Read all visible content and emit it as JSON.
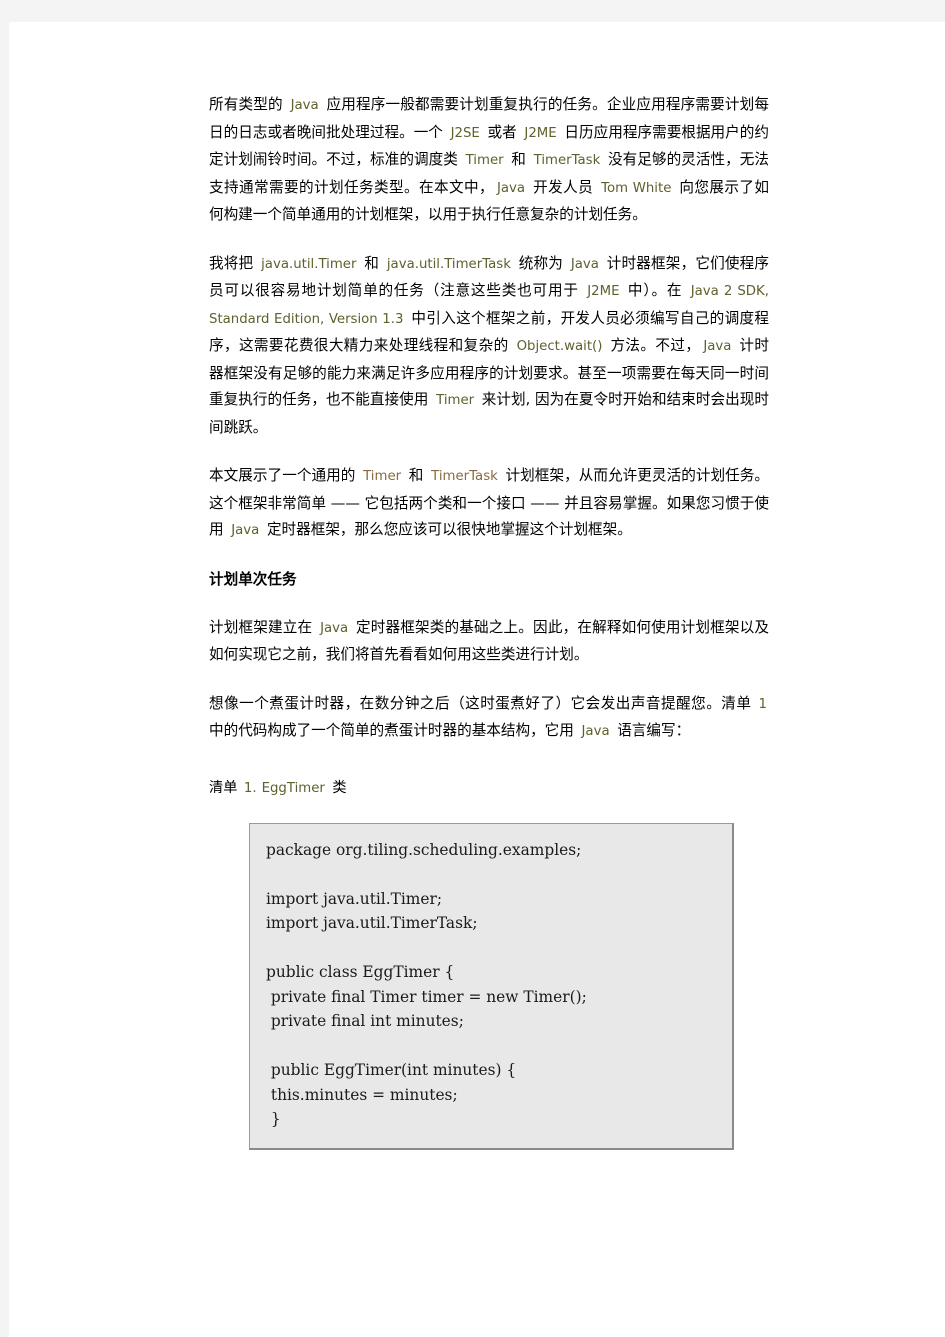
{
  "page": {
    "background_color": "#f4f4f4",
    "paper_color": "#ffffff",
    "accent_code_color": "#60602e",
    "accent_link_color": "#8a6a40"
  },
  "paragraphs": {
    "p1": {
      "s1": "所有类型的 ",
      "c1": "Java",
      "s2": " 应用程序一般都需要计划重复执行的任务。企业应用程序需要计划每日的日志或者晚间批处理过程。一个 ",
      "c2": "J2SE",
      "s3": " 或者 ",
      "c3": "J2ME",
      "s4": " 日历应用程序需要根据用户的约定计划闹铃时间。不过，标准的调度类 ",
      "c4": "Timer",
      "s5": " 和 ",
      "c5": "TimerTask",
      "s6": " 没有足够的灵活性，无法支持通常需要的计划任务类型。在本文中，",
      "c6": "Java",
      "s7": " 开发人员 ",
      "c7": "Tom White",
      "s8": " 向您展示了如何构建一个简单通用的计划框架，以用于执行任意复杂的计划任务。"
    },
    "p2": {
      "s1": "我将把 ",
      "c1": "java.util.Timer",
      "s2": " 和 ",
      "c2": "java.util.TimerTask",
      "s3": " 统称为 ",
      "c3": "Java",
      "s4": " 计时器框架，它们使程序员可以很容易地计划简单的任务（注意这些类也可用于 ",
      "c4": "J2ME",
      "s5": " 中）。在 ",
      "c5": "Java 2 SDK, Standard Edition, Version 1.3",
      "s6": " 中引入这个框架之前，开发人员必须编写自己的调度程序，这需要花费很大精力来处理线程和复杂的 ",
      "c6": "Object.wait()",
      "s7": " 方法。不过，",
      "c7": "Java",
      "s8": " 计时器框架没有足够的能力来满足许多应用程序的计划要求。甚至一项需要在每天同一时间重复执行的任务，也不能直接使用 ",
      "c8": "Timer",
      "s9": " 来计划, 因为在夏令时开始和结束时会出现时间跳跃。"
    },
    "p3": {
      "s1": "本文展示了一个通用的 ",
      "c1": "Timer",
      "s2": " 和 ",
      "c2": "TimerTask",
      "s3": " 计划框架，从而允许更灵活的计划任务。这个框架非常简单 —— 它包括两个类和一个接口 —— 并且容易掌握。如果您习惯于使用 ",
      "c3": "Java",
      "s4": " 定时器框架，那么您应该可以很快地掌握这个计划框架。"
    },
    "p4": {
      "s1": "计划框架建立在 ",
      "c1": "Java",
      "s2": " 定时器框架类的基础之上。因此，在解释如何使用计划框架以及如何实现它之前，我们将首先看看如何用这些类进行计划。"
    },
    "p5": {
      "s1": "想像一个煮蛋计时器，在数分钟之后（这时蛋煮好了）它会发出声音提醒您。清单 ",
      "c1": "1",
      "s2": " 中的代码构成了一个简单的煮蛋计时器的基本结构，它用 ",
      "c2": "Java",
      "s3": " 语言编写："
    }
  },
  "headings": {
    "h1": "计划单次任务"
  },
  "listing": {
    "caption_prefix": "清单 ",
    "caption_number": "1.",
    "caption_class": "EggTimer",
    "caption_suffix": " 类",
    "code": "package org.tiling.scheduling.examples;\n\nimport java.util.Timer;\nimport java.util.TimerTask;\n\npublic class EggTimer {\n private final Timer timer = new Timer();\n private final int minutes;\n\n public EggTimer(int minutes) {\n this.minutes = minutes;\n }"
  }
}
